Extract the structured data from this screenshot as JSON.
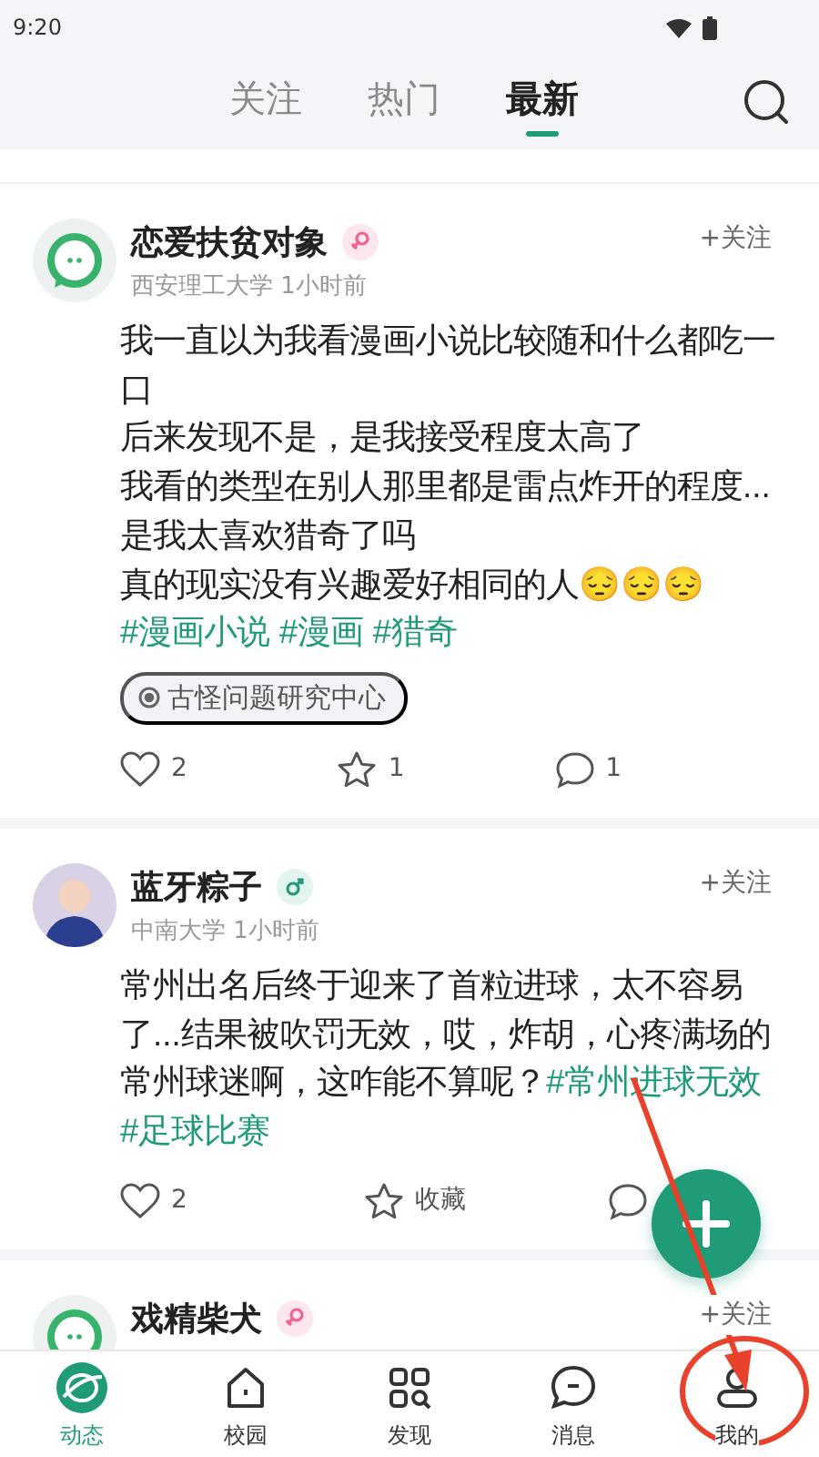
{
  "status_bar": {
    "time": "9:20"
  },
  "tabs": [
    {
      "label": "关注",
      "selected": false
    },
    {
      "label": "热门",
      "selected": false
    },
    {
      "label": "最新",
      "selected": true
    }
  ],
  "posts": [
    {
      "avatar": {
        "kind": "logo"
      },
      "name": "恋爱扶贫对象",
      "gender": {
        "kind": "female"
      },
      "school": "西安理工大学",
      "time": "1小时前",
      "follow": "+关注",
      "paragraphs": [
        "我一直以为我看漫画小说比较随和什么都吃一口",
        "后来发现不是，是我接受程度太高了",
        "我看的类型在别人那里都是雷点炸开的程度...",
        "是我太喜欢猎奇了吗",
        "真的现实没有兴趣爱好相同的人😔😔😔"
      ],
      "tags": [
        "#漫画小说",
        "#漫画",
        "#猎奇"
      ],
      "circle": "古怪问题研究中心",
      "actions": [
        {
          "kind": "like",
          "label": "2"
        },
        {
          "kind": "favorite",
          "label": "1"
        },
        {
          "kind": "comment",
          "label": "1"
        }
      ]
    },
    {
      "avatar": {
        "kind": "photo"
      },
      "name": "蓝牙粽子",
      "gender": {
        "kind": "male"
      },
      "school": "中南大学",
      "time": "1小时前",
      "follow": "+关注",
      "paragraphs": [
        "常州出名后终于迎来了首粒进球，太不容易了...结果被吹罚无效，哎，炸胡，心疼满场的常州球迷啊，这咋能不算呢？"
      ],
      "tags": [
        "#常州进球无效",
        "#足球比赛"
      ],
      "actions": [
        {
          "kind": "like",
          "label": "2"
        },
        {
          "kind": "favorite",
          "label": "收藏"
        },
        {
          "kind": "comment"
        }
      ]
    },
    {
      "avatar": {
        "kind": "logo"
      },
      "name": "戏精柴犬",
      "gender": {
        "kind": "female"
      },
      "follow": "+关注"
    }
  ],
  "nav": [
    {
      "kind": "feed",
      "label": "动态",
      "selected": true
    },
    {
      "kind": "campus",
      "label": "校园",
      "selected": false
    },
    {
      "kind": "discover",
      "label": "发现",
      "selected": false
    },
    {
      "kind": "messages",
      "label": "消息",
      "selected": false
    },
    {
      "kind": "profile",
      "label": "我的",
      "selected": false
    }
  ]
}
